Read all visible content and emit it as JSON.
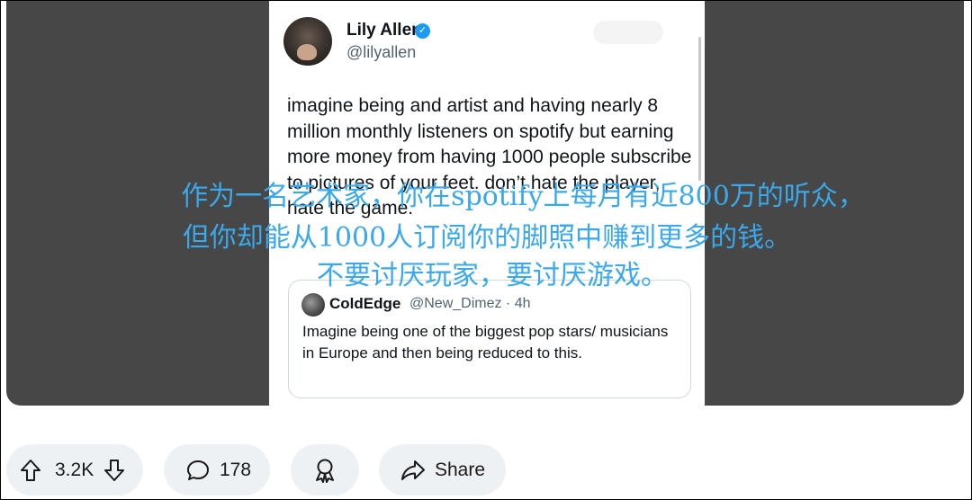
{
  "tweet": {
    "author_name": "Lily Allen",
    "author_handle": "@lilyallen",
    "text": "imagine being and artist and having nearly 8 million monthly listeners on spotify but earning more money from having 1000 people subscribe to pictures of your feet. don’t hate the player, hate the game.",
    "quote": {
      "author_name": "ColdEdge",
      "handle_time": "@New_Dimez · 4h",
      "text": "Imagine being one of the biggest pop stars/ musicians in Europe and then being reduced to this."
    }
  },
  "subtitles": {
    "line1": "作为一名艺术家，你在spotify上每月有近800万的听众，",
    "line2": "但你却能从1000人订阅你的脚照中赚到更多的钱。",
    "line3": "不要讨厌玩家，要讨厌游戏。"
  },
  "actions": {
    "vote_count": "3.2K",
    "comment_count": "178",
    "share_label": "Share"
  },
  "colors": {
    "subtitle": "#3aa8ea",
    "verified_badge": "#1d9bf0",
    "pill_background": "#eef1f3"
  }
}
